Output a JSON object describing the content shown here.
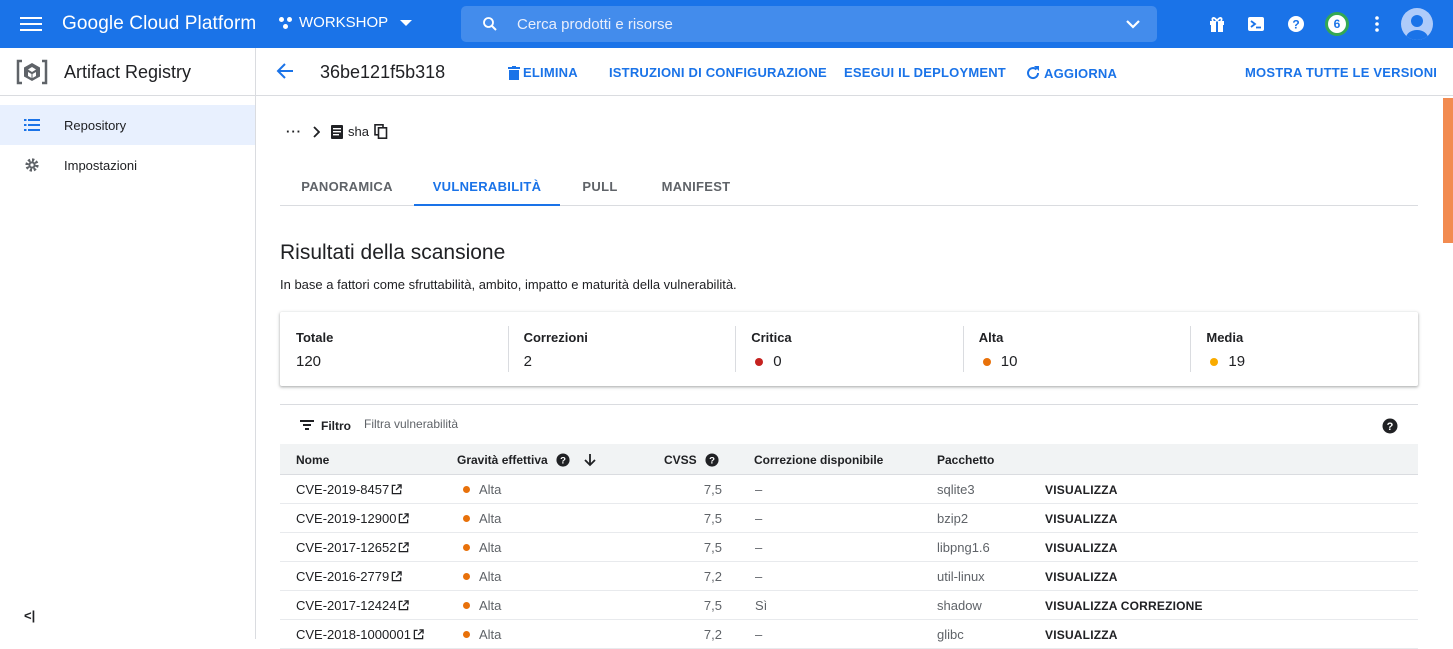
{
  "topbar": {
    "brand": "Google Cloud Platform",
    "project": "WORKSHOP",
    "search_placeholder": "Cerca prodotti e risorse",
    "notification_count": "6"
  },
  "sidebar": {
    "title": "Artifact Registry",
    "items": [
      {
        "label": "Repository",
        "icon": "list-icon",
        "active": true
      },
      {
        "label": "Impostazioni",
        "icon": "gear-icon",
        "active": false
      }
    ],
    "collapse_label": "<|"
  },
  "header": {
    "digest": "36be121f5b318",
    "actions": {
      "delete": "ELIMINA",
      "setup": "ISTRUZIONI DI CONFIGURAZIONE",
      "deploy": "ESEGUI IL DEPLOYMENT",
      "refresh": "AGGIORNA",
      "all_versions": "MOSTRA TUTTE LE VERSIONI"
    }
  },
  "breadcrumb": {
    "more": "···",
    "current": "sha"
  },
  "tabs": [
    "PANORAMICA",
    "VULNERABILITÀ",
    "PULL",
    "MANIFEST"
  ],
  "active_tab": "VULNERABILITÀ",
  "scan": {
    "heading": "Risultati della scansione",
    "description": "In base a fattori come sfruttabilità, ambito, impatto e maturità della vulnerabilità.",
    "stats": [
      {
        "label": "Totale",
        "value": "120"
      },
      {
        "label": "Correzioni",
        "value": "2"
      },
      {
        "label": "Critica",
        "value": "0",
        "color": "#c5221f"
      },
      {
        "label": "Alta",
        "value": "10",
        "color": "#e8710a"
      },
      {
        "label": "Media",
        "value": "19",
        "color": "#f9ab00"
      }
    ]
  },
  "filter": {
    "label": "Filtro",
    "placeholder": "Filtra vulnerabilità"
  },
  "table": {
    "columns": {
      "name": "Nome",
      "severity": "Gravità effettiva",
      "cvss": "CVSS",
      "fix": "Correzione disponibile",
      "package": "Pacchetto"
    },
    "rows": [
      {
        "name": "CVE-2019-8457",
        "severity": "Alta",
        "cvss": "7,5",
        "fix": "–",
        "package": "sqlite3",
        "action": "VISUALIZZA"
      },
      {
        "name": "CVE-2019-12900",
        "severity": "Alta",
        "cvss": "7,5",
        "fix": "–",
        "package": "bzip2",
        "action": "VISUALIZZA"
      },
      {
        "name": "CVE-2017-12652",
        "severity": "Alta",
        "cvss": "7,5",
        "fix": "–",
        "package": "libpng1.6",
        "action": "VISUALIZZA"
      },
      {
        "name": "CVE-2016-2779",
        "severity": "Alta",
        "cvss": "7,2",
        "fix": "–",
        "package": "util-linux",
        "action": "VISUALIZZA"
      },
      {
        "name": "CVE-2017-12424",
        "severity": "Alta",
        "cvss": "7,5",
        "fix": "Sì",
        "package": "shadow",
        "action": "VISUALIZZA CORREZIONE"
      },
      {
        "name": "CVE-2018-1000001",
        "severity": "Alta",
        "cvss": "7,2",
        "fix": "–",
        "package": "glibc",
        "action": "VISUALIZZA"
      }
    ]
  },
  "colors": {
    "accent": "#1a73e8",
    "high": "#e8710a",
    "critical": "#c5221f",
    "medium": "#f9ab00"
  }
}
